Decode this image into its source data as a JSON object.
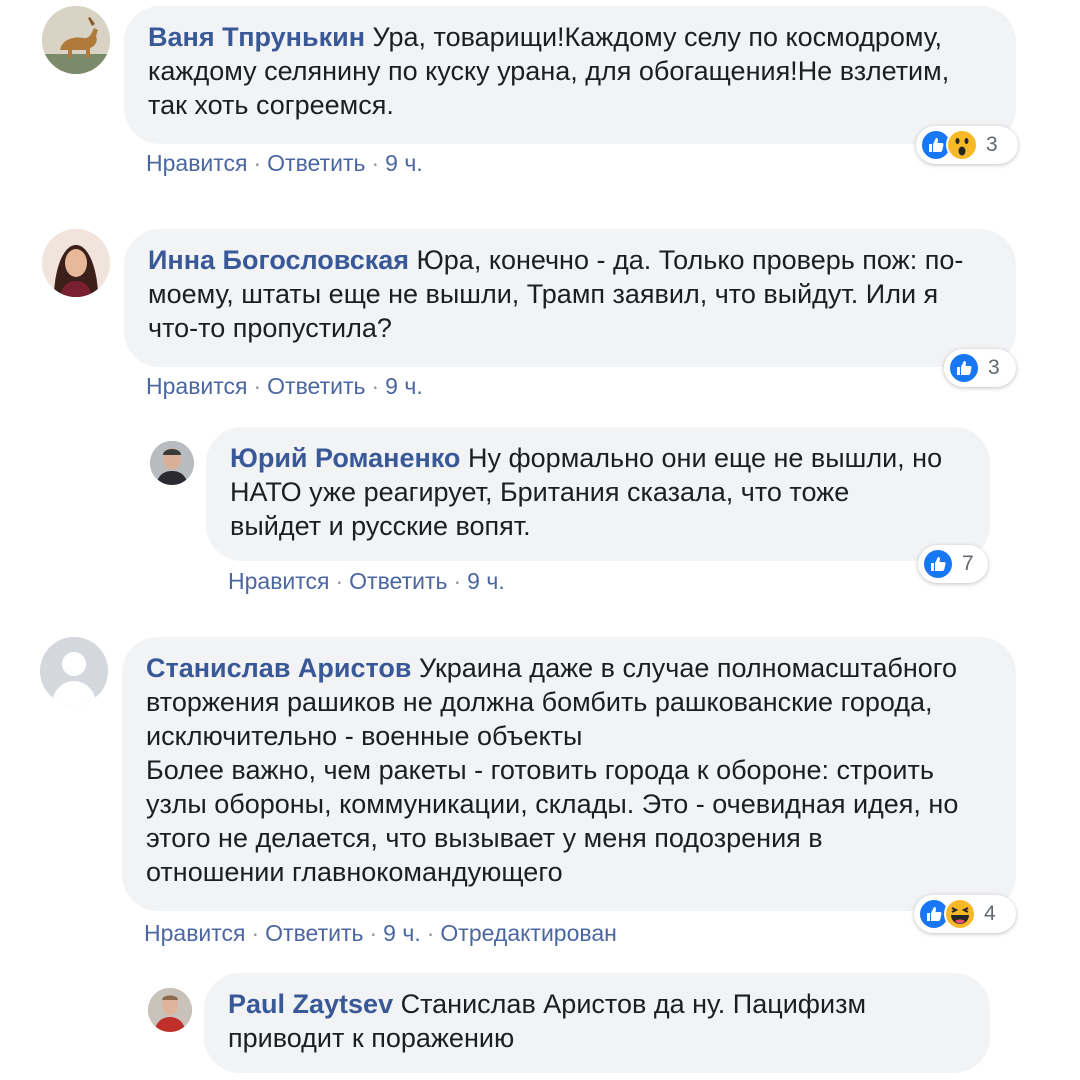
{
  "comments": [
    {
      "author": "Ваня Тпрунькин",
      "lines": [
        "Ура, товарищи!Каждому селу по космодрому,",
        "каждому селянину по куску урана, для обогащения!Не взлетим,",
        "так хоть согреемся."
      ],
      "actions": {
        "like": "Нравится",
        "reply": "Ответить",
        "time": "9 ч."
      },
      "reactions": {
        "icons": [
          "like-icon",
          "wow-icon"
        ],
        "count": "3"
      }
    },
    {
      "author": "Инна Богословская",
      "lines": [
        "Юра, конечно - да. Только проверь пож: по-",
        "моему, штаты еще не вышли, Трамп заявил, что выйдут. Или я",
        "что-то пропустила?"
      ],
      "actions": {
        "like": "Нравится",
        "reply": "Ответить",
        "time": "9 ч."
      },
      "reactions": {
        "icons": [
          "like-icon"
        ],
        "count": "3"
      }
    },
    {
      "author": "Юрий Романенко",
      "lines": [
        "Ну формально они еще не вышли, но",
        "НАТО уже реагирует, Британия сказала, что тоже",
        "выйдет и русские вопят."
      ],
      "actions": {
        "like": "Нравится",
        "reply": "Ответить",
        "time": "9 ч."
      },
      "reactions": {
        "icons": [
          "like-icon"
        ],
        "count": "7"
      }
    },
    {
      "author": "Станислав Аристов",
      "lines": [
        "Украина даже в случае полномасштабного",
        "вторжения рашиков не должна бомбить рашкованские города,",
        "исключительно - военные объекты",
        "Более важно, чем ракеты - готовить города к обороне: строить",
        "узлы обороны, коммуникации, склады. Это - очевидная идея, но",
        "этого не делается, что вызывает у меня подозрения в",
        "отношении главнокомандующего"
      ],
      "actions": {
        "like": "Нравится",
        "reply": "Ответить",
        "time": "9 ч.",
        "edited": "Отредактирован"
      },
      "reactions": {
        "icons": [
          "like-icon",
          "haha-icon"
        ],
        "count": "4"
      }
    },
    {
      "author": "Paul Zaytsev",
      "lines": [
        "Станислав Аристов да ну. Пацифизм",
        "приводит к поражению"
      ]
    }
  ],
  "colors": {
    "author": "#385898",
    "bubble": "#f2f3f5",
    "link": "#4b67a1",
    "like": "#1877f2",
    "emoji": "#f7b928"
  }
}
